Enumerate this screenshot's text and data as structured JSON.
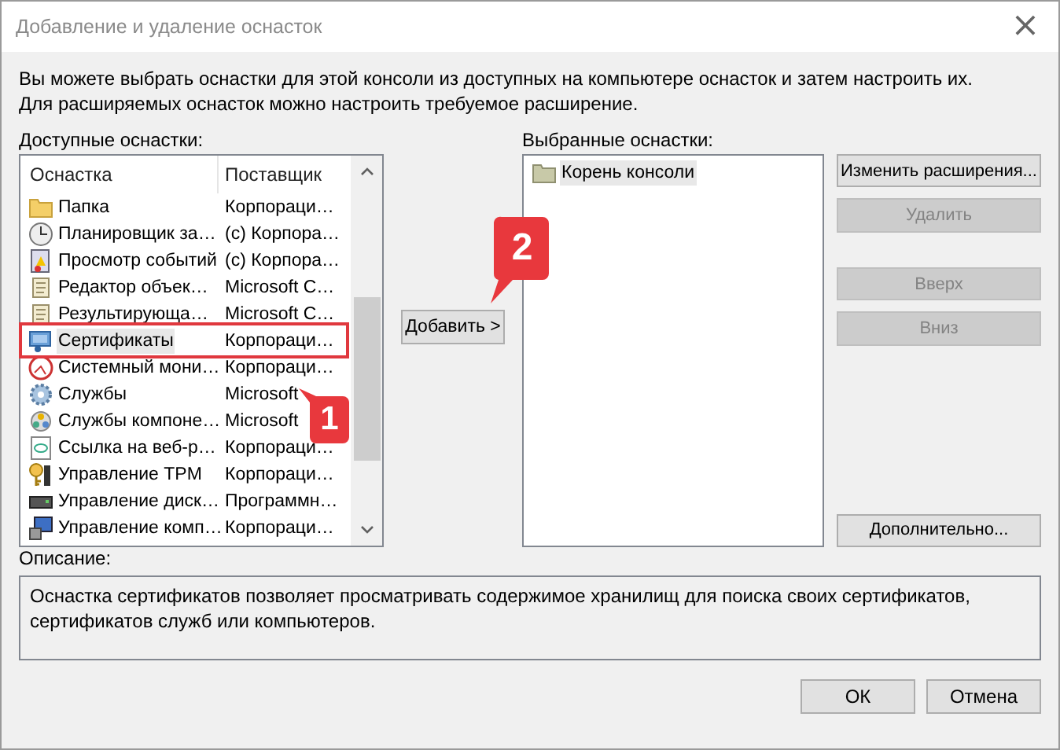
{
  "window": {
    "title": "Добавление и удаление оснасток",
    "close": "×"
  },
  "intro": "Вы можете выбрать оснастки для этой консоли из доступных на компьютере оснасток и затем настроить их. Для расширяемых оснасток можно настроить требуемое расширение.",
  "available": {
    "label": "Доступные оснастки:",
    "columns": [
      "Оснастка",
      "Поставщик"
    ],
    "rows": [
      {
        "kind": "folder",
        "name": "Папка",
        "vendor": "Корпораци…",
        "selected": false,
        "highlighted": false
      },
      {
        "kind": "clock",
        "name": "Планировщик за…",
        "vendor": "(c) Корпора…",
        "selected": false,
        "highlighted": false
      },
      {
        "kind": "log",
        "name": "Просмотр событий",
        "vendor": "(c) Корпора…",
        "selected": false,
        "highlighted": false
      },
      {
        "kind": "scroll",
        "name": "Редактор объек…",
        "vendor": "Microsoft C…",
        "selected": false,
        "highlighted": false
      },
      {
        "kind": "scroll",
        "name": "Результирующа…",
        "vendor": "Microsoft C…",
        "selected": false,
        "highlighted": false
      },
      {
        "kind": "cert",
        "name": "Сертификаты",
        "vendor": "Корпораци…",
        "selected": true,
        "highlighted": true,
        "callout": "1"
      },
      {
        "kind": "gauge",
        "name": "Системный мони…",
        "vendor": "Корпораци…",
        "selected": false,
        "highlighted": false
      },
      {
        "kind": "gear",
        "name": "Службы",
        "vendor": "Microsoft",
        "selected": false,
        "highlighted": false
      },
      {
        "kind": "component",
        "name": "Службы компоне…",
        "vendor": "Microsoft",
        "selected": false,
        "highlighted": false
      },
      {
        "kind": "link",
        "name": "Ссылка на веб-р…",
        "vendor": "Корпораци…",
        "selected": false,
        "highlighted": false
      },
      {
        "kind": "key",
        "name": "Управление TPM",
        "vendor": "Корпораци…",
        "selected": false,
        "highlighted": false
      },
      {
        "kind": "disk",
        "name": "Управление диск…",
        "vendor": "Программн…",
        "selected": false,
        "highlighted": false
      },
      {
        "kind": "computer",
        "name": "Управление комп…",
        "vendor": "Корпораци…",
        "selected": false,
        "highlighted": false
      }
    ]
  },
  "add_button": {
    "label": "Добавить >",
    "callout": "2"
  },
  "selected_snapins": {
    "label": "Выбранные оснастки:",
    "items": [
      {
        "name": "Корень консоли",
        "selected": true
      }
    ]
  },
  "side_buttons": [
    {
      "label": "Изменить расширения...",
      "disabled": false
    },
    {
      "label": "Удалить",
      "disabled": true
    },
    {
      "label": "Вверх",
      "disabled": true
    },
    {
      "label": "Вниз",
      "disabled": true
    },
    {
      "label": "Дополнительно...",
      "disabled": false
    }
  ],
  "description": {
    "label": "Описание:",
    "text": "Оснастка сертификатов позволяет просматривать содержимое хранилищ для поиска своих сертификатов, сертификатов служб или компьютеров."
  },
  "footer_buttons": [
    {
      "label": "ОК"
    },
    {
      "label": "Отмена"
    }
  ]
}
